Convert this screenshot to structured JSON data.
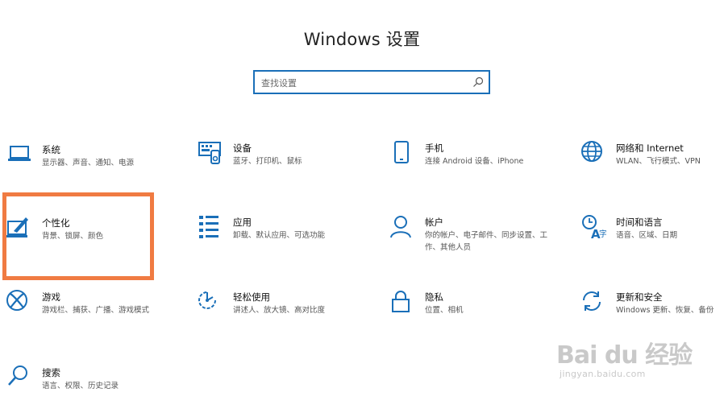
{
  "window": {
    "title": "Windows 设置"
  },
  "search": {
    "placeholder": "查找设置",
    "icon": "search-icon"
  },
  "accent_color": "#1a6fb8",
  "highlight_color": "#f07b42",
  "tiles": [
    {
      "name": "系统",
      "desc": "显示器、声音、通知、电源",
      "icon": "laptop-icon"
    },
    {
      "name": "设备",
      "desc": "蓝牙、打印机、鼠标",
      "icon": "devices-icon"
    },
    {
      "name": "手机",
      "desc": "连接 Android 设备、iPhone",
      "icon": "phone-icon"
    },
    {
      "name": "网络和 Internet",
      "desc": "WLAN、飞行模式、VPN",
      "icon": "globe-icon"
    },
    {
      "name": "个性化",
      "desc": "背景、锁屏、颜色",
      "icon": "personalize-icon"
    },
    {
      "name": "应用",
      "desc": "卸载、默认应用、可选功能",
      "icon": "apps-list-icon"
    },
    {
      "name": "帐户",
      "desc": "你的帐户、电子邮件、同步设置、工作、其他人员",
      "icon": "account-icon"
    },
    {
      "name": "时间和语言",
      "desc": "语音、区域、日期",
      "icon": "time-language-icon"
    },
    {
      "name": "游戏",
      "desc": "游戏栏、捕获、广播、游戏模式",
      "icon": "xbox-icon"
    },
    {
      "name": "轻松使用",
      "desc": "讲述人、放大镜、高对比度",
      "icon": "ease-of-access-icon"
    },
    {
      "name": "隐私",
      "desc": "位置、相机",
      "icon": "lock-icon"
    },
    {
      "name": "更新和安全",
      "desc": "Windows 更新、恢复、备份",
      "icon": "update-icon"
    },
    {
      "name": "搜索",
      "desc": "语言、权限、历史记录",
      "icon": "search-icon"
    }
  ],
  "watermark": {
    "brand": "Bai du 经验",
    "url": "jingyan.baidu.com"
  }
}
